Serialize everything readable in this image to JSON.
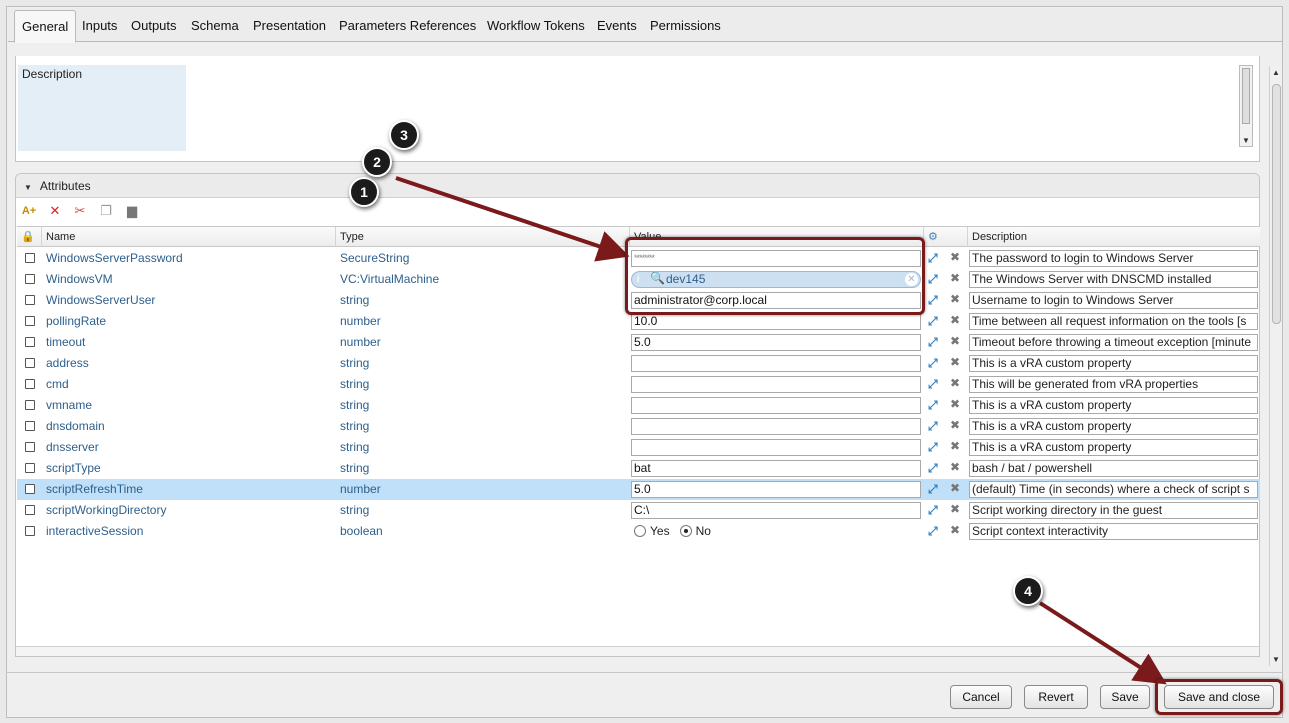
{
  "tabs": [
    {
      "label": "General",
      "active": true
    },
    {
      "label": "Inputs"
    },
    {
      "label": "Outputs"
    },
    {
      "label": "Schema"
    },
    {
      "label": "Presentation"
    },
    {
      "label": "Parameters References"
    },
    {
      "label": "Workflow Tokens"
    },
    {
      "label": "Events"
    },
    {
      "label": "Permissions"
    }
  ],
  "description": {
    "label": "Description"
  },
  "attributes": {
    "title": "Attributes",
    "columns": {
      "name": "Name",
      "type": "Type",
      "value": "Value",
      "description": "Description"
    },
    "rows": [
      {
        "name": "WindowsServerPassword",
        "type": "SecureString",
        "value": "********",
        "kind": "password",
        "description": "The password to login to Windows Server"
      },
      {
        "name": "WindowsVM",
        "type": "VC:VirtualMachine",
        "value": "dev145",
        "kind": "vc",
        "description": "The Windows Server with DNSCMD installed"
      },
      {
        "name": "WindowsServerUser",
        "type": "string",
        "value": "administrator@corp.local",
        "kind": "text",
        "description": "Username to login to Windows Server"
      },
      {
        "name": "pollingRate",
        "type": "number",
        "value": "10.0",
        "kind": "text",
        "description": "Time between all request information on the tools [s"
      },
      {
        "name": "timeout",
        "type": "number",
        "value": "5.0",
        "kind": "text",
        "description": "Timeout before throwing a timeout exception [minute"
      },
      {
        "name": "address",
        "type": "string",
        "value": "",
        "kind": "text",
        "description": "This is a vRA custom property"
      },
      {
        "name": "cmd",
        "type": "string",
        "value": "",
        "kind": "text",
        "description": "This will be generated from vRA properties"
      },
      {
        "name": "vmname",
        "type": "string",
        "value": "",
        "kind": "text",
        "description": "This is a vRA custom property"
      },
      {
        "name": "dnsdomain",
        "type": "string",
        "value": "",
        "kind": "text",
        "description": "This is a vRA custom property"
      },
      {
        "name": "dnsserver",
        "type": "string",
        "value": "",
        "kind": "text",
        "description": "This is a vRA custom property"
      },
      {
        "name": "scriptType",
        "type": "string",
        "value": "bat",
        "kind": "text",
        "description": "bash / bat / powershell"
      },
      {
        "name": "scriptRefreshTime",
        "type": "number",
        "value": "5.0",
        "kind": "text",
        "selected": true,
        "description": "(default) Time (in seconds) where a check of script s"
      },
      {
        "name": "scriptWorkingDirectory",
        "type": "string",
        "value": "C:\\",
        "kind": "text",
        "description": "Script working directory in the guest"
      },
      {
        "name": "interactiveSession",
        "type": "boolean",
        "value": "No",
        "kind": "bool",
        "options": [
          "Yes",
          "No"
        ],
        "description": "Script context interactivity"
      }
    ]
  },
  "buttons": {
    "cancel": "Cancel",
    "revert": "Revert",
    "save": "Save",
    "save_close": "Save and close"
  },
  "callouts": [
    "1",
    "2",
    "3",
    "4"
  ],
  "colors": {
    "annotation": "#7b1a1a",
    "link_text": "#2d5f8c",
    "selected_row": "#bfe0f8"
  }
}
